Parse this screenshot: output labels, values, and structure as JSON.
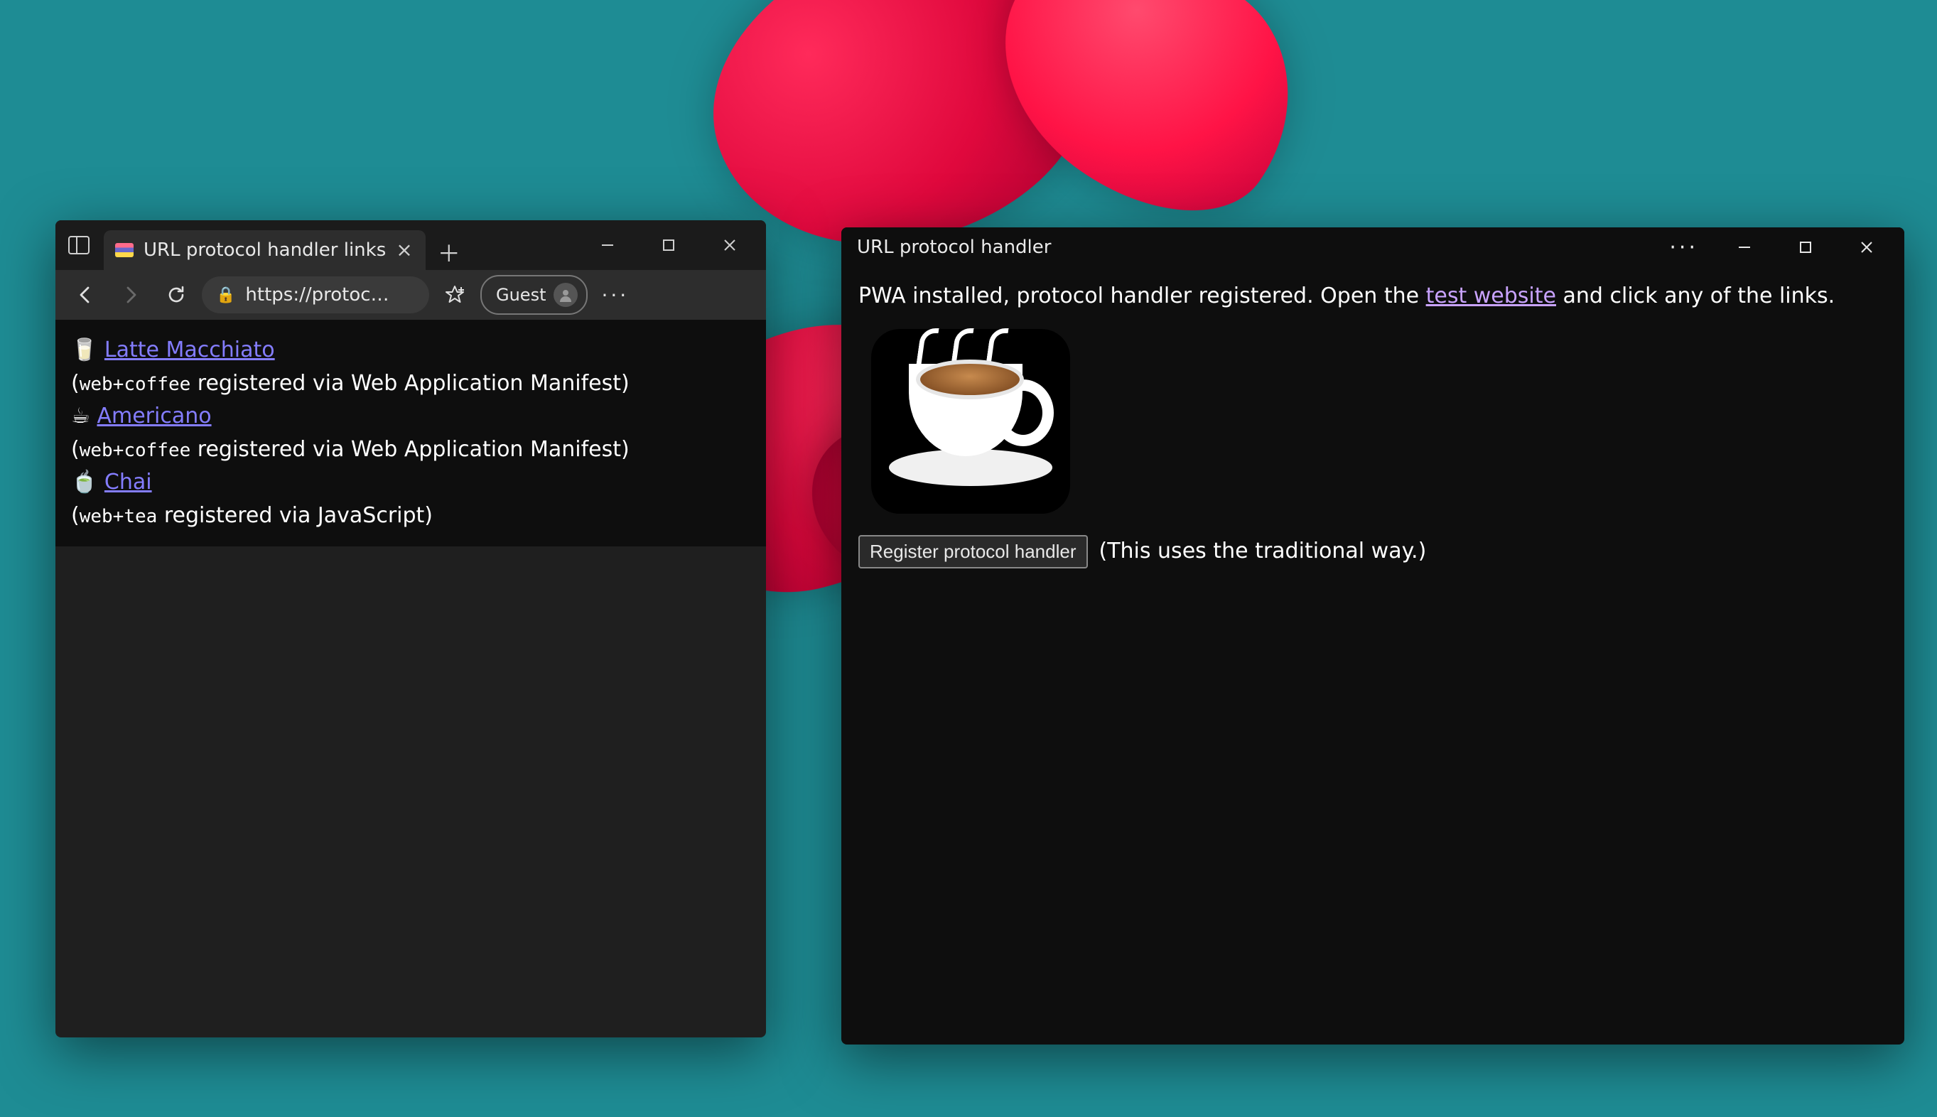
{
  "browser": {
    "tab_title": "URL protocol handler links",
    "address": "https://protoc…",
    "guest_label": "Guest",
    "page": {
      "items": [
        {
          "emoji": "🥛",
          "name": "Latte Macchiato",
          "note_prefix": "(",
          "proto": "web+coffee",
          "note_suffix": " registered via Web Application Manifest)"
        },
        {
          "emoji": "☕",
          "name": "Americano",
          "note_prefix": "(",
          "proto": "web+coffee",
          "note_suffix": " registered via Web Application Manifest)"
        },
        {
          "emoji": "🍵",
          "name": "Chai",
          "note_prefix": "(",
          "proto": "web+tea",
          "note_suffix": " registered via JavaScript)"
        }
      ]
    }
  },
  "pwa": {
    "title": "URL protocol handler",
    "installed_prefix": "PWA installed, protocol handler registered. Open the ",
    "test_link": "test website",
    "installed_suffix": " and click any of the links.",
    "register_button": "Register protocol handler",
    "register_note": "(This uses the traditional way.)"
  }
}
